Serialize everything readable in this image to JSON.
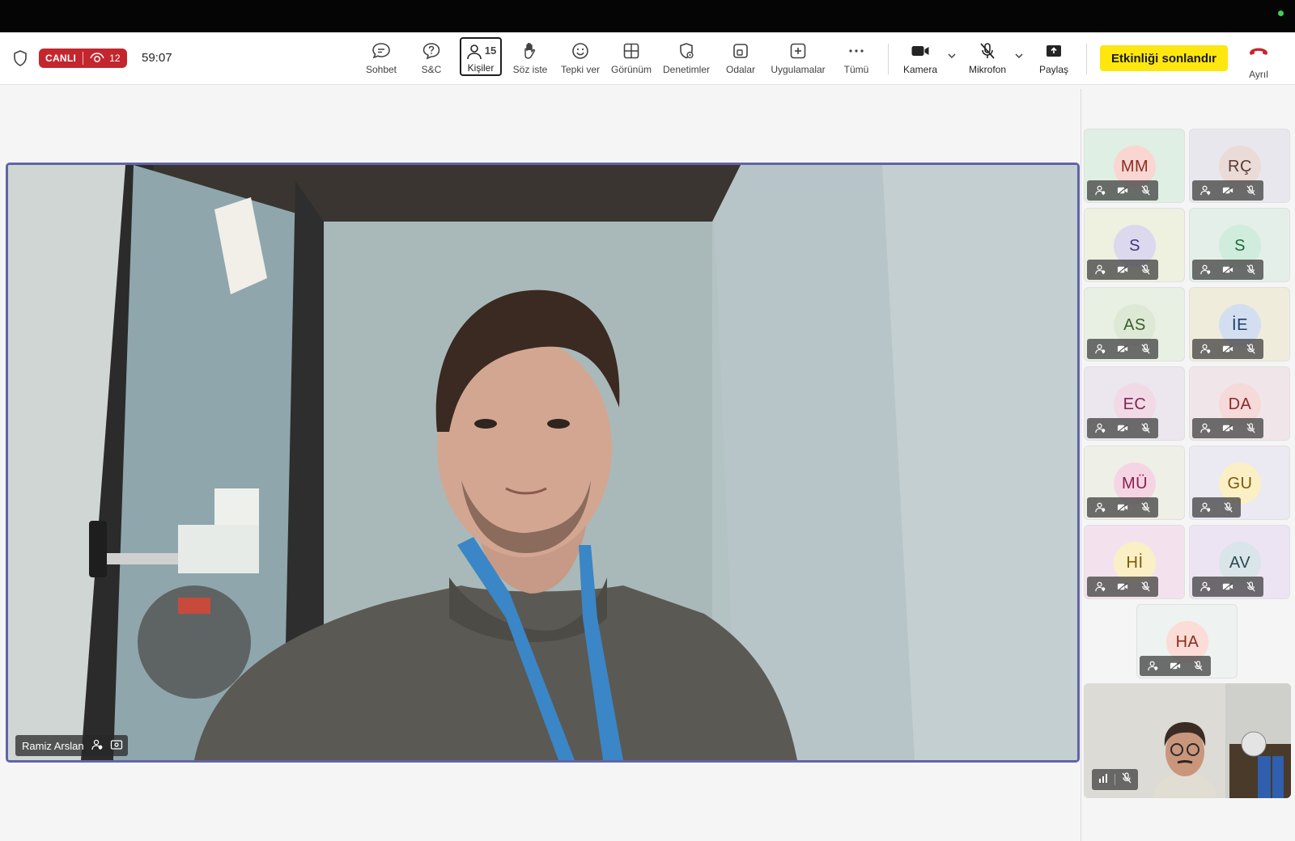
{
  "status": {
    "live_label": "CANLI",
    "viewer_count": "12",
    "timer": "59:07"
  },
  "toolbar": {
    "chat": "Sohbet",
    "qa": "S&C",
    "people": "Kişiler",
    "people_count": "15",
    "raise_hand": "Söz iste",
    "react": "Tepki ver",
    "view": "Görünüm",
    "controls": "Denetimler",
    "rooms": "Odalar",
    "apps": "Uygulamalar",
    "more": "Tümü",
    "camera": "Kamera",
    "mic": "Mikrofon",
    "share": "Paylaş",
    "end_event": "Etkinliği sonlandır",
    "leave": "Ayrıl"
  },
  "main_video": {
    "presenter_name": "Ramiz Arslan"
  },
  "participants": [
    {
      "initials": "MM",
      "avatar_bg": "#f9d6d2",
      "avatar_fg": "#8a2c22",
      "tile_bg": "#dfefe4"
    },
    {
      "initials": "RÇ",
      "avatar_bg": "#eadbd6",
      "avatar_fg": "#5b3a31",
      "tile_bg": "#e9e7ee"
    },
    {
      "initials": "S",
      "avatar_bg": "#dcd8ee",
      "avatar_fg": "#3f3a78",
      "tile_bg": "#eef0e0"
    },
    {
      "initials": "S",
      "avatar_bg": "#cfecdc",
      "avatar_fg": "#1d6a3e",
      "tile_bg": "#e4efe9"
    },
    {
      "initials": "AS",
      "avatar_bg": "#dde9d5",
      "avatar_fg": "#3d5a2c",
      "tile_bg": "#e8f0e4"
    },
    {
      "initials": "İE",
      "avatar_bg": "#d3dff0",
      "avatar_fg": "#1f3d6b",
      "tile_bg": "#f0ecdc"
    },
    {
      "initials": "EC",
      "avatar_bg": "#f2d9e6",
      "avatar_fg": "#7a2854",
      "tile_bg": "#ece6ee"
    },
    {
      "initials": "DA",
      "avatar_bg": "#f6d9d9",
      "avatar_fg": "#8c2929",
      "tile_bg": "#f0e6ea"
    },
    {
      "initials": "MÜ",
      "avatar_bg": "#f5d5e4",
      "avatar_fg": "#8b1e52",
      "tile_bg": "#eef0e8"
    },
    {
      "initials": "GU",
      "avatar_bg": "#fbf0c5",
      "avatar_fg": "#7a5a0c",
      "tile_bg": "#ebe9f2"
    },
    {
      "initials": "Hİ",
      "avatar_bg": "#fbf0c5",
      "avatar_fg": "#7a5a0c",
      "tile_bg": "#f3e2ee"
    },
    {
      "initials": "AV",
      "avatar_bg": "#d9e5e8",
      "avatar_fg": "#2b4a52",
      "tile_bg": "#ece3f3"
    },
    {
      "initials": "HA",
      "avatar_bg": "#fbdcd6",
      "avatar_fg": "#8b2c1e",
      "tile_bg": "#eef2f0"
    }
  ],
  "colors": {
    "live": "#c4262e",
    "end_button": "#fde70e",
    "active_speaker_border": "#6264a7",
    "leave_icon": "#c4262e"
  }
}
